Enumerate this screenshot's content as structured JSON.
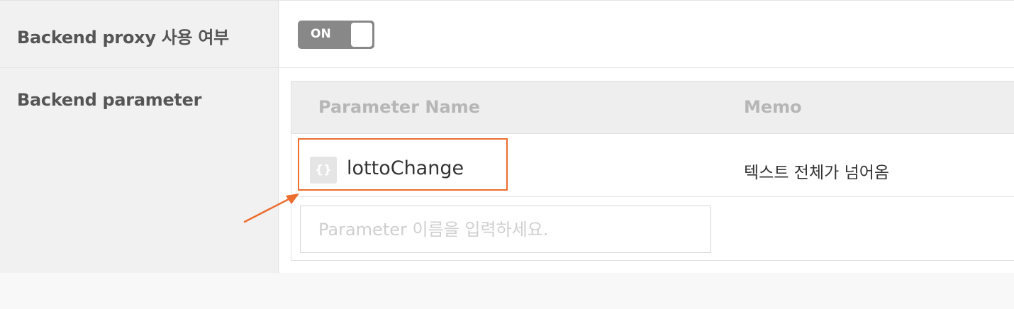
{
  "rows": {
    "proxy": {
      "label": "Backend proxy 사용 여부",
      "toggle_state": "ON"
    },
    "parameter": {
      "label": "Backend parameter",
      "table": {
        "headers": [
          "Parameter Name",
          "Memo"
        ],
        "rows": [
          {
            "icon": "variable-braces-icon",
            "icon_text": "{}",
            "name": "lottoChange",
            "memo": "텍스트 전체가 넘어옴"
          }
        ]
      },
      "input": {
        "placeholder": "Parameter 이름을 입력하세요.",
        "value": ""
      }
    }
  },
  "annotation": {
    "color": "#ec6d2e"
  }
}
